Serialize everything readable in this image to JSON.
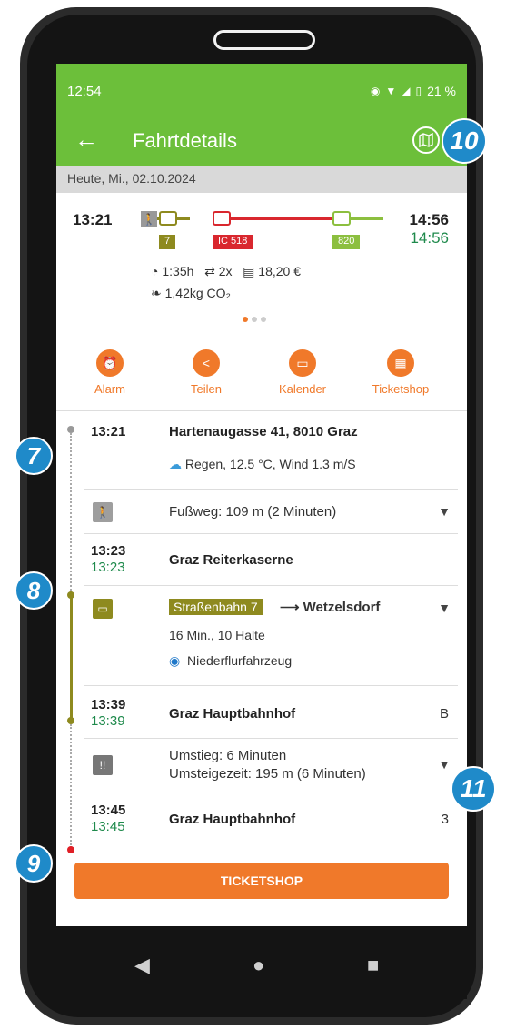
{
  "statusbar": {
    "time": "12:54",
    "battery": "21 %"
  },
  "appbar": {
    "title": "Fahrtdetails",
    "back_icon": "arrow-left-icon",
    "map_icon": "map-icon"
  },
  "date": "Heute, Mi., 02.10.2024",
  "summary": {
    "dep_time": "13:21",
    "arr_time_planned": "14:56",
    "arr_time_actual": "14:56",
    "legs": [
      {
        "type": "walk",
        "label": ""
      },
      {
        "type": "tram",
        "label": "7",
        "color": "#8e8a1f"
      },
      {
        "type": "train",
        "label": "IC 518",
        "color": "#d9272e"
      },
      {
        "type": "bus",
        "label": "820",
        "color": "#8cbf3f"
      }
    ],
    "duration": "1:35h",
    "changes": "2x",
    "price": "18,20 €",
    "co2": "1,42kg CO₂"
  },
  "actions": [
    {
      "label": "Alarm",
      "icon": "alarm-icon"
    },
    {
      "label": "Teilen",
      "icon": "share-icon"
    },
    {
      "label": "Kalender",
      "icon": "calendar-icon"
    },
    {
      "label": "Ticketshop",
      "icon": "ticket-icon"
    }
  ],
  "itinerary": {
    "stop1": {
      "time": "13:21",
      "name": "Hartenaugasse 41, 8010 Graz",
      "weather": "Regen, 12.5 °C, Wind 1.3 m/S"
    },
    "walk": {
      "text": "Fußweg: 109 m (2 Minuten)"
    },
    "stop2": {
      "time": "13:23",
      "time_actual": "13:23",
      "name": "Graz Reiterkaserne"
    },
    "tram": {
      "line": "Straßenbahn 7",
      "direction": "⟶ Wetzelsdorf",
      "info": "16 Min., 10 Halte",
      "feature": "Niederflurfahrzeug"
    },
    "stop3": {
      "time": "13:39",
      "time_actual": "13:39",
      "name": "Graz Hauptbahnhof",
      "track": "B"
    },
    "transfer": {
      "line1": "Umstieg: 6 Minuten",
      "line2": "Umsteigezeit: 195 m (6 Minuten)"
    },
    "stop4": {
      "time": "13:45",
      "time_actual": "13:45",
      "name": "Graz Hauptbahnhof",
      "track": "3"
    }
  },
  "button": {
    "ticketshop": "TICKETSHOP"
  },
  "callouts": {
    "c7": "7",
    "c8": "8",
    "c9": "9",
    "c10": "10",
    "c11": "11"
  },
  "colors": {
    "green": "#6cbf3a",
    "orange": "#f0792a",
    "tram": "#8e8a1f"
  }
}
